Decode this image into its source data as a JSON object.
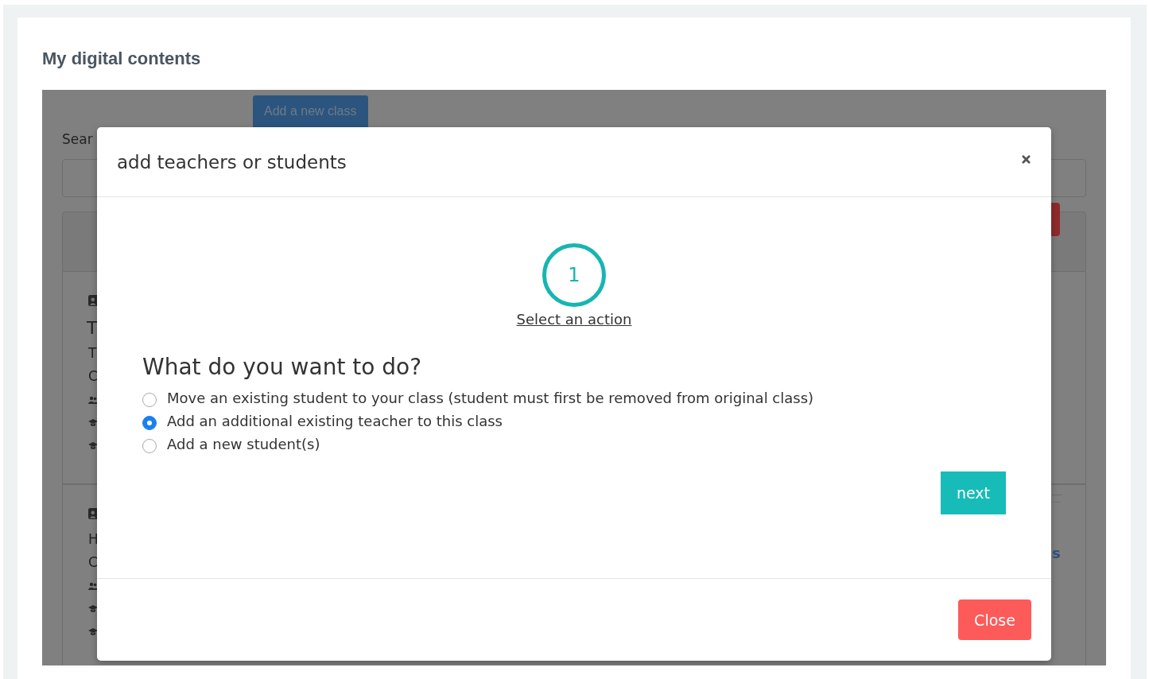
{
  "page": {
    "title": "My digital contents"
  },
  "background": {
    "add_class_button": "Add a new class",
    "search_label": "Sear",
    "cards": [
      {
        "heading": "T",
        "lines": [
          "T",
          "C"
        ]
      },
      {
        "lines": [
          "H",
          "C"
        ]
      }
    ],
    "link": "s"
  },
  "modal": {
    "title": "add teachers or students",
    "step": {
      "number": "1",
      "label": "Select an action"
    },
    "question": "What do you want to do?",
    "options": [
      {
        "label": "Move an existing student to your class (student must first be removed from original class)",
        "selected": false
      },
      {
        "label": "Add an additional existing teacher to this class",
        "selected": true
      },
      {
        "label": "Add a new student(s)",
        "selected": false
      }
    ],
    "next_button": "next",
    "close_button": "Close"
  }
}
